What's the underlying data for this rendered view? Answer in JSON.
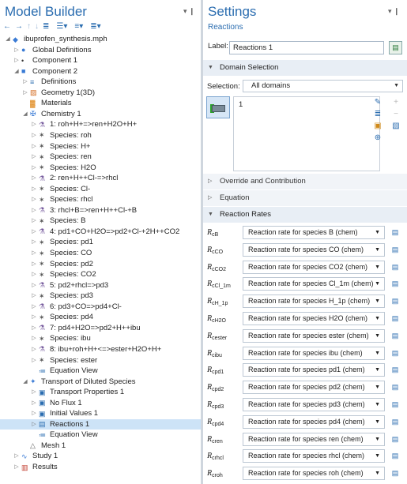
{
  "model_builder": {
    "title": "Model Builder",
    "pin": "▾ ❙",
    "toolbar": [
      "←",
      "→",
      "↑",
      "↓",
      "≣",
      "☰▾",
      "≡▾",
      "≣▾"
    ]
  },
  "tree": [
    {
      "label": "ibuprofen_synthesis.mph",
      "indent": 0,
      "toggle": "◢",
      "icon": "model-icon",
      "glyph": "◆",
      "color": "#3a7bd5"
    },
    {
      "label": "Global Definitions",
      "indent": 1,
      "toggle": "▷",
      "icon": "globe-icon",
      "glyph": "●",
      "color": "#3a7bd5"
    },
    {
      "label": "Component 1",
      "indent": 1,
      "toggle": "▷",
      "icon": "dot-icon",
      "glyph": "•",
      "color": "#333"
    },
    {
      "label": "Component 2",
      "indent": 1,
      "toggle": "◢",
      "icon": "component-icon",
      "glyph": "■",
      "color": "#3a7bd5"
    },
    {
      "label": "Definitions",
      "indent": 2,
      "toggle": "▷",
      "icon": "definitions-icon",
      "glyph": "≡",
      "color": "#2b6db0"
    },
    {
      "label": "Geometry 1(3D)",
      "indent": 2,
      "toggle": "▷",
      "icon": "geometry-icon",
      "glyph": "▨",
      "color": "#d2691e"
    },
    {
      "label": "Materials",
      "indent": 2,
      "toggle": "",
      "icon": "materials-icon",
      "glyph": "▓",
      "color": "#e08a1e"
    },
    {
      "label": "Chemistry 1",
      "indent": 2,
      "toggle": "◢",
      "icon": "chemistry-icon",
      "glyph": "✠",
      "color": "#3a7bd5"
    },
    {
      "label": "1: roh+H+=>ren+H2O+H+",
      "indent": 3,
      "toggle": "▷",
      "icon": "reaction-icon",
      "glyph": "⚗",
      "color": "#7a5fa0"
    },
    {
      "label": "Species: roh",
      "indent": 3,
      "toggle": "▷",
      "icon": "species-icon",
      "glyph": "✶",
      "color": "#555"
    },
    {
      "label": "Species: H+",
      "indent": 3,
      "toggle": "▷",
      "icon": "species-icon",
      "glyph": "✶",
      "color": "#555"
    },
    {
      "label": "Species: ren",
      "indent": 3,
      "toggle": "▷",
      "icon": "species-icon",
      "glyph": "✶",
      "color": "#555"
    },
    {
      "label": "Species: H2O",
      "indent": 3,
      "toggle": "▷",
      "icon": "species-icon",
      "glyph": "✶",
      "color": "#555"
    },
    {
      "label": "2: ren+H++Cl-=>rhcl",
      "indent": 3,
      "toggle": "▷",
      "icon": "reaction-icon",
      "glyph": "⚗",
      "color": "#7a5fa0"
    },
    {
      "label": "Species: Cl-",
      "indent": 3,
      "toggle": "▷",
      "icon": "species-icon",
      "glyph": "✶",
      "color": "#555"
    },
    {
      "label": "Species: rhcl",
      "indent": 3,
      "toggle": "▷",
      "icon": "species-icon",
      "glyph": "✶",
      "color": "#555"
    },
    {
      "label": "3: rhcl+B=>ren+H++Cl-+B",
      "indent": 3,
      "toggle": "▷",
      "icon": "reaction-icon",
      "glyph": "⚗",
      "color": "#7a5fa0"
    },
    {
      "label": "Species: B",
      "indent": 3,
      "toggle": "▷",
      "icon": "species-icon",
      "glyph": "✶",
      "color": "#555"
    },
    {
      "label": "4: pd1+CO+H2O=>pd2+Cl-+2H++CO2",
      "indent": 3,
      "toggle": "▷",
      "icon": "reaction-icon",
      "glyph": "⚗",
      "color": "#7a5fa0"
    },
    {
      "label": "Species: pd1",
      "indent": 3,
      "toggle": "▷",
      "icon": "species-icon",
      "glyph": "✶",
      "color": "#555"
    },
    {
      "label": "Species: CO",
      "indent": 3,
      "toggle": "▷",
      "icon": "species-icon",
      "glyph": "✶",
      "color": "#555"
    },
    {
      "label": "Species: pd2",
      "indent": 3,
      "toggle": "▷",
      "icon": "species-icon",
      "glyph": "✶",
      "color": "#555"
    },
    {
      "label": "Species: CO2",
      "indent": 3,
      "toggle": "▷",
      "icon": "species-icon",
      "glyph": "✶",
      "color": "#555"
    },
    {
      "label": "5: pd2+rhcl=>pd3",
      "indent": 3,
      "toggle": "▷",
      "icon": "reaction-icon",
      "glyph": "⚗",
      "color": "#7a5fa0"
    },
    {
      "label": "Species: pd3",
      "indent": 3,
      "toggle": "▷",
      "icon": "species-icon",
      "glyph": "✶",
      "color": "#555"
    },
    {
      "label": "6: pd3+CO=>pd4+Cl-",
      "indent": 3,
      "toggle": "▷",
      "icon": "reaction-icon",
      "glyph": "⚗",
      "color": "#7a5fa0"
    },
    {
      "label": "Species: pd4",
      "indent": 3,
      "toggle": "▷",
      "icon": "species-icon",
      "glyph": "✶",
      "color": "#555"
    },
    {
      "label": "7: pd4+H2O=>pd2+H++ibu",
      "indent": 3,
      "toggle": "▷",
      "icon": "reaction-icon",
      "glyph": "⚗",
      "color": "#7a5fa0"
    },
    {
      "label": "Species: ibu",
      "indent": 3,
      "toggle": "▷",
      "icon": "species-icon",
      "glyph": "✶",
      "color": "#555"
    },
    {
      "label": "8: ibu+roh+H+<=>ester+H2O+H+",
      "indent": 3,
      "toggle": "▷",
      "icon": "reaction-icon",
      "glyph": "⚗",
      "color": "#7a5fa0"
    },
    {
      "label": "Species: ester",
      "indent": 3,
      "toggle": "▷",
      "icon": "species-icon",
      "glyph": "✶",
      "color": "#555"
    },
    {
      "label": "Equation View",
      "indent": 3,
      "toggle": "",
      "icon": "equation-view-icon",
      "glyph": "≔",
      "color": "#2b6db0"
    },
    {
      "label": "Transport of Diluted Species",
      "indent": 2,
      "toggle": "◢",
      "icon": "transport-icon",
      "glyph": "✦",
      "color": "#3a7bd5"
    },
    {
      "label": "Transport Properties 1",
      "indent": 3,
      "toggle": "▷",
      "icon": "feature-icon",
      "glyph": "▣",
      "color": "#2b6db0"
    },
    {
      "label": "No Flux 1",
      "indent": 3,
      "toggle": "▷",
      "icon": "feature-icon",
      "glyph": "▣",
      "color": "#2b6db0"
    },
    {
      "label": "Initial Values 1",
      "indent": 3,
      "toggle": "▷",
      "icon": "feature-icon",
      "glyph": "▣",
      "color": "#2b6db0"
    },
    {
      "label": "Reactions 1",
      "indent": 3,
      "toggle": "▷",
      "icon": "reactions-feature-icon",
      "glyph": "▤",
      "color": "#2b6db0",
      "selected": true
    },
    {
      "label": "Equation View",
      "indent": 3,
      "toggle": "",
      "icon": "equation-view-icon",
      "glyph": "≔",
      "color": "#2b6db0"
    },
    {
      "label": "Mesh 1",
      "indent": 2,
      "toggle": "",
      "icon": "mesh-icon",
      "glyph": "△",
      "color": "#666"
    },
    {
      "label": "Study 1",
      "indent": 1,
      "toggle": "▷",
      "icon": "study-icon",
      "glyph": "∿",
      "color": "#3a7bd5"
    },
    {
      "label": "Results",
      "indent": 1,
      "toggle": "▷",
      "icon": "results-icon",
      "glyph": "▥",
      "color": "#c0392b"
    }
  ],
  "settings": {
    "title": "Settings",
    "pin": "▾ ❙",
    "subtitle": "Reactions",
    "label_text": "Label:",
    "label_value": "Reactions 1",
    "domain_section": "Domain Selection",
    "selection_label": "Selection:",
    "selection_value": "All domains",
    "domain_list": [
      "1"
    ],
    "override": "Override and Contribution",
    "equation": "Equation",
    "reaction_rates": "Reaction Rates"
  },
  "rates": [
    {
      "sym": "R",
      "sub": "cB",
      "value": "Reaction rate for species B (chem)"
    },
    {
      "sym": "R",
      "sub": "cCO",
      "value": "Reaction rate for species CO (chem)"
    },
    {
      "sym": "R",
      "sub": "cCO2",
      "value": "Reaction rate for species CO2 (chem)"
    },
    {
      "sym": "R",
      "sub": "cCl_1m",
      "value": "Reaction rate for species Cl_1m (chem)"
    },
    {
      "sym": "R",
      "sub": "cH_1p",
      "value": "Reaction rate for species H_1p (chem)"
    },
    {
      "sym": "R",
      "sub": "cH2O",
      "value": "Reaction rate for species H2O (chem)"
    },
    {
      "sym": "R",
      "sub": "cester",
      "value": "Reaction rate for species ester (chem)"
    },
    {
      "sym": "R",
      "sub": "cibu",
      "value": "Reaction rate for species ibu (chem)"
    },
    {
      "sym": "R",
      "sub": "cpd1",
      "value": "Reaction rate for species pd1 (chem)"
    },
    {
      "sym": "R",
      "sub": "cpd2",
      "value": "Reaction rate for species pd2 (chem)"
    },
    {
      "sym": "R",
      "sub": "cpd3",
      "value": "Reaction rate for species pd3 (chem)"
    },
    {
      "sym": "R",
      "sub": "cpd4",
      "value": "Reaction rate for species pd4 (chem)"
    },
    {
      "sym": "R",
      "sub": "cren",
      "value": "Reaction rate for species ren (chem)"
    },
    {
      "sym": "R",
      "sub": "crhcl",
      "value": "Reaction rate for species rhcl (chem)"
    },
    {
      "sym": "R",
      "sub": "croh",
      "value": "Reaction rate for species roh (chem)"
    }
  ]
}
